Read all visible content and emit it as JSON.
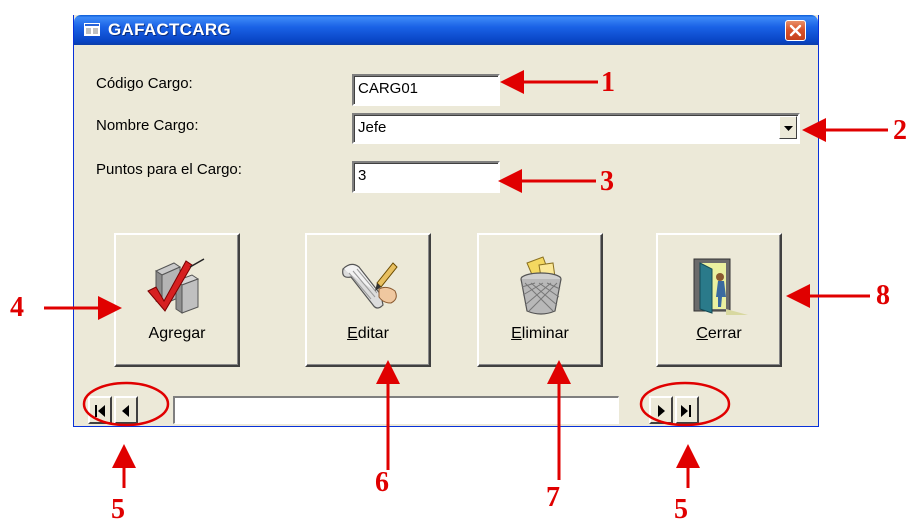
{
  "window": {
    "title": "GAFACTCARG"
  },
  "form": {
    "codigo_label": "Código Cargo:",
    "codigo_value": "CARG01",
    "nombre_label": "Nombre Cargo:",
    "nombre_value": "Jefe",
    "puntos_label": "Puntos para el Cargo:",
    "puntos_value": "3"
  },
  "buttons": {
    "agregar": {
      "pre": "A",
      "underline": "g",
      "post": "regar",
      "icon": "add-record-icon"
    },
    "editar": {
      "pre": "",
      "underline": "E",
      "post": "ditar",
      "icon": "edit-scroll-icon"
    },
    "eliminar": {
      "pre": "",
      "underline": "E",
      "post": "liminar",
      "icon": "trash-bin-icon"
    },
    "cerrar": {
      "pre": "",
      "underline": "C",
      "post": "errar",
      "icon": "exit-door-icon"
    }
  },
  "navigation": {
    "first": "first-record-icon",
    "previous": "previous-record-icon",
    "next": "next-record-icon",
    "last": "last-record-icon",
    "record_text": ""
  },
  "annotations": {
    "n1": "1",
    "n2": "2",
    "n3": "3",
    "n4": "4",
    "n5_left": "5",
    "n5_right": "5",
    "n6": "6",
    "n7": "7",
    "n8": "8"
  },
  "colors": {
    "annotation": "#e00000",
    "titlebar": "#0844c4",
    "window_face": "#ece9d8",
    "close_button": "#d9542b"
  }
}
